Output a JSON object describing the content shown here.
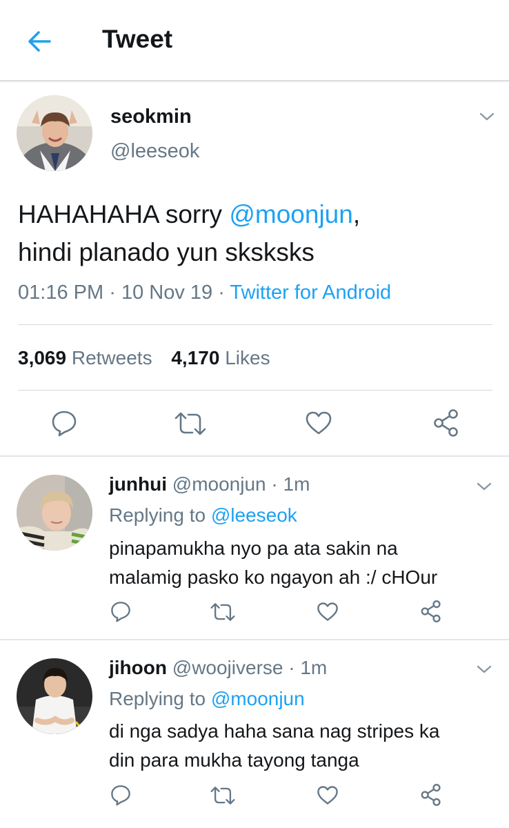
{
  "header": {
    "title": "Tweet"
  },
  "tweet": {
    "name": "seokmin",
    "handle": "@leeseok",
    "text_before": "HAHAHAHA sorry ",
    "mention": "@moonjun",
    "text_mid": ",",
    "text_line2": "hindi planado yun sksksks",
    "time": "01:16 PM",
    "date": "10 Nov 19",
    "sep": "·",
    "source": "Twitter for Android",
    "retweets_count": "3,069",
    "retweets_label": "Retweets",
    "likes_count": "4,170",
    "likes_label": "Likes"
  },
  "replies": [
    {
      "name": "junhui",
      "handle": "@moonjun",
      "sep": "·",
      "time": "1m",
      "replying_label": "Replying to",
      "replying_to": "@leeseok",
      "line1": "pinapamukha nyo pa ata sakin na",
      "line2": "malamig pasko ko ngayon ah :/ cHOur"
    },
    {
      "name": "jihoon",
      "handle": "@woojiverse",
      "sep": "·",
      "time": "1m",
      "replying_label": "Replying to",
      "replying_to": "@moonjun",
      "line1": "di nga sadya haha sana nag stripes ka",
      "line2": "din para mukha tayong tanga"
    }
  ],
  "icons": {
    "back": "arrow-left-icon",
    "chevron": "chevron-down-icon",
    "reply": "reply-icon",
    "retweet": "retweet-icon",
    "like": "heart-icon",
    "share": "share-icon"
  },
  "colors": {
    "accent": "#1da1f2",
    "muted": "#657786",
    "text": "#14171a",
    "icon": "#657786"
  }
}
